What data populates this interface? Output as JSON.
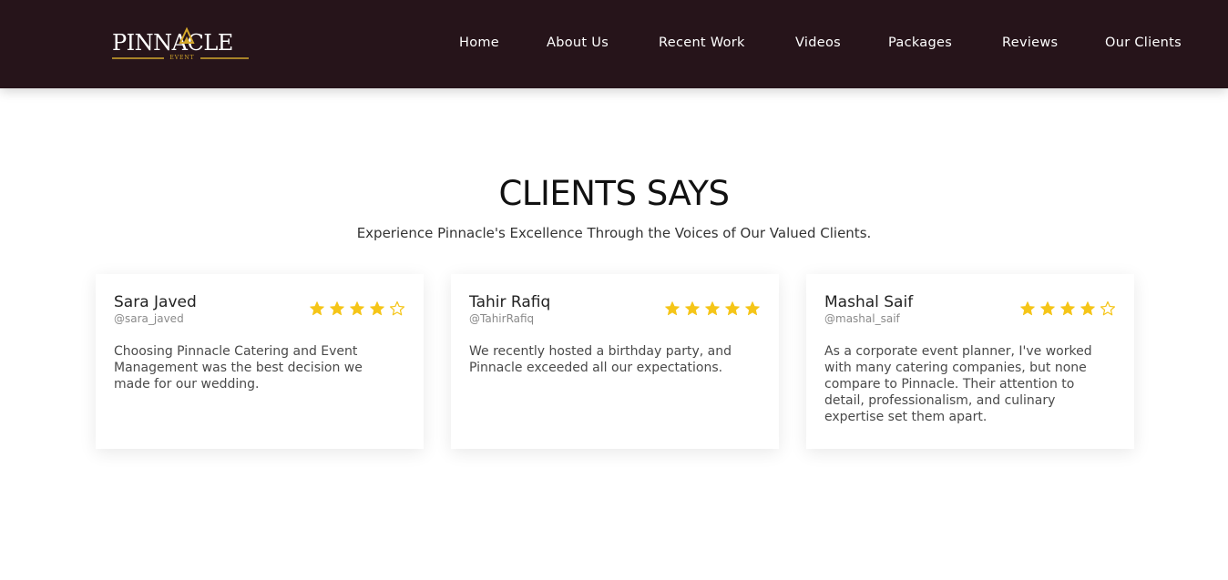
{
  "brand": {
    "logo_text": "PINNACLE",
    "logo_subtext": "EVENT",
    "accent": "#d4a82c"
  },
  "nav": {
    "items": [
      {
        "label": "Home"
      },
      {
        "label": "About Us"
      },
      {
        "label": "Recent Work"
      },
      {
        "label": "Videos"
      },
      {
        "label": "Packages"
      },
      {
        "label": "Reviews"
      },
      {
        "label": "Our Clients"
      }
    ]
  },
  "section": {
    "title": "CLIENTS SAYS",
    "subtitle": "Experience Pinnacle's Excellence Through the Voices of Our Valued Clients."
  },
  "reviews": [
    {
      "name": "Sara Javed",
      "handle": "@sara_javed",
      "rating": 4,
      "max_rating": 5,
      "text": "Choosing Pinnacle Catering and Event Management was the best decision we made for our wedding."
    },
    {
      "name": "Tahir Rafiq",
      "handle": "@TahirRafiq",
      "rating": 5,
      "max_rating": 5,
      "text": "We recently hosted a birthday party, and Pinnacle exceeded all our expectations."
    },
    {
      "name": "Mashal Saif",
      "handle": "@mashal_saif",
      "rating": 4,
      "max_rating": 5,
      "text": "As a corporate event planner, I've worked with many catering companies, but none compare to Pinnacle. Their attention to detail, professionalism, and culinary expertise set them apart."
    }
  ],
  "colors": {
    "header_bg": "#26141a",
    "star_filled": "#f5c518",
    "star_empty": "#f5c518",
    "text_dark": "#222222"
  },
  "icons": {
    "star_filled": "star-filled-icon",
    "star_empty": "star-outline-icon"
  }
}
